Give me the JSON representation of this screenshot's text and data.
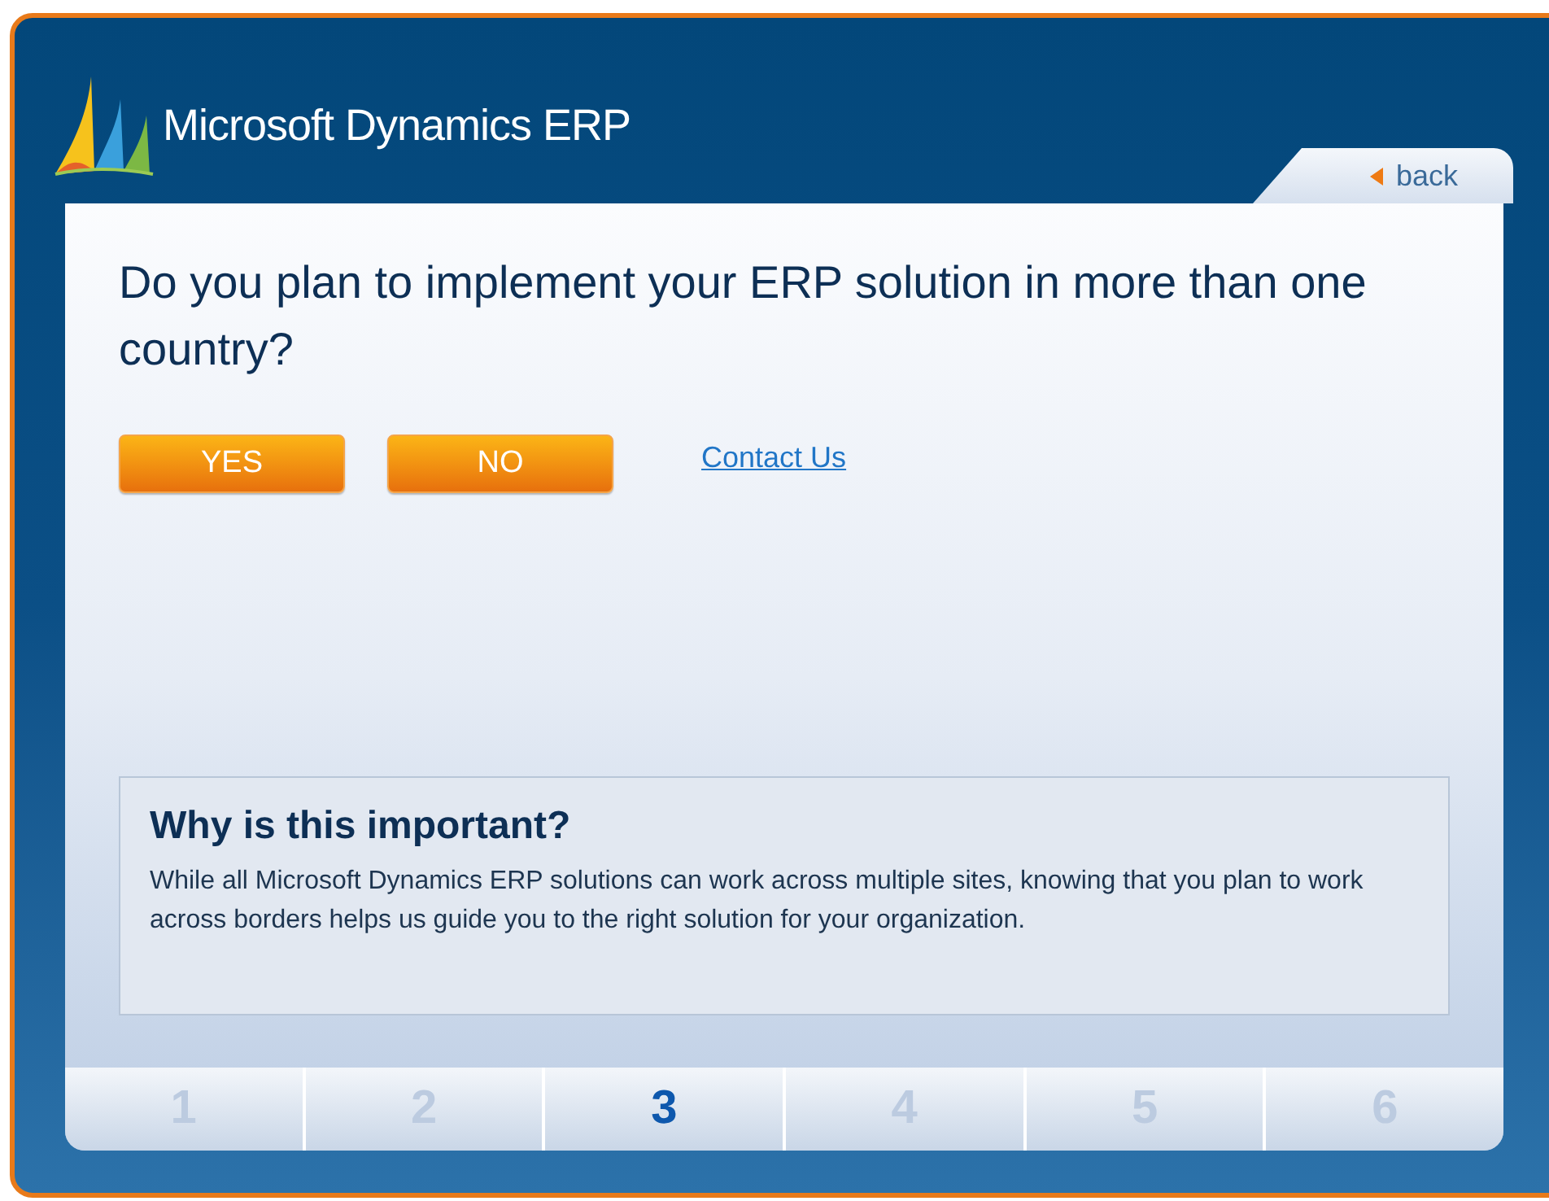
{
  "logo": {
    "text": "Microsoft Dynamics ERP"
  },
  "back": {
    "label": "back"
  },
  "question": "Do you plan to implement your ERP solution in more than one country?",
  "answers": [
    "YES",
    "NO"
  ],
  "contact_link": "Contact Us",
  "info": {
    "title": "Why is this important?",
    "body": "While all Microsoft Dynamics ERP solutions can work across multiple sites, knowing that you plan to work across borders helps us guide you to the right solution for your organization."
  },
  "steps": [
    {
      "label": "1",
      "selected": false
    },
    {
      "label": "2",
      "selected": false
    },
    {
      "label": "3",
      "selected": true
    },
    {
      "label": "4",
      "selected": false
    },
    {
      "label": "5",
      "selected": false
    },
    {
      "label": "6",
      "selected": false
    }
  ]
}
